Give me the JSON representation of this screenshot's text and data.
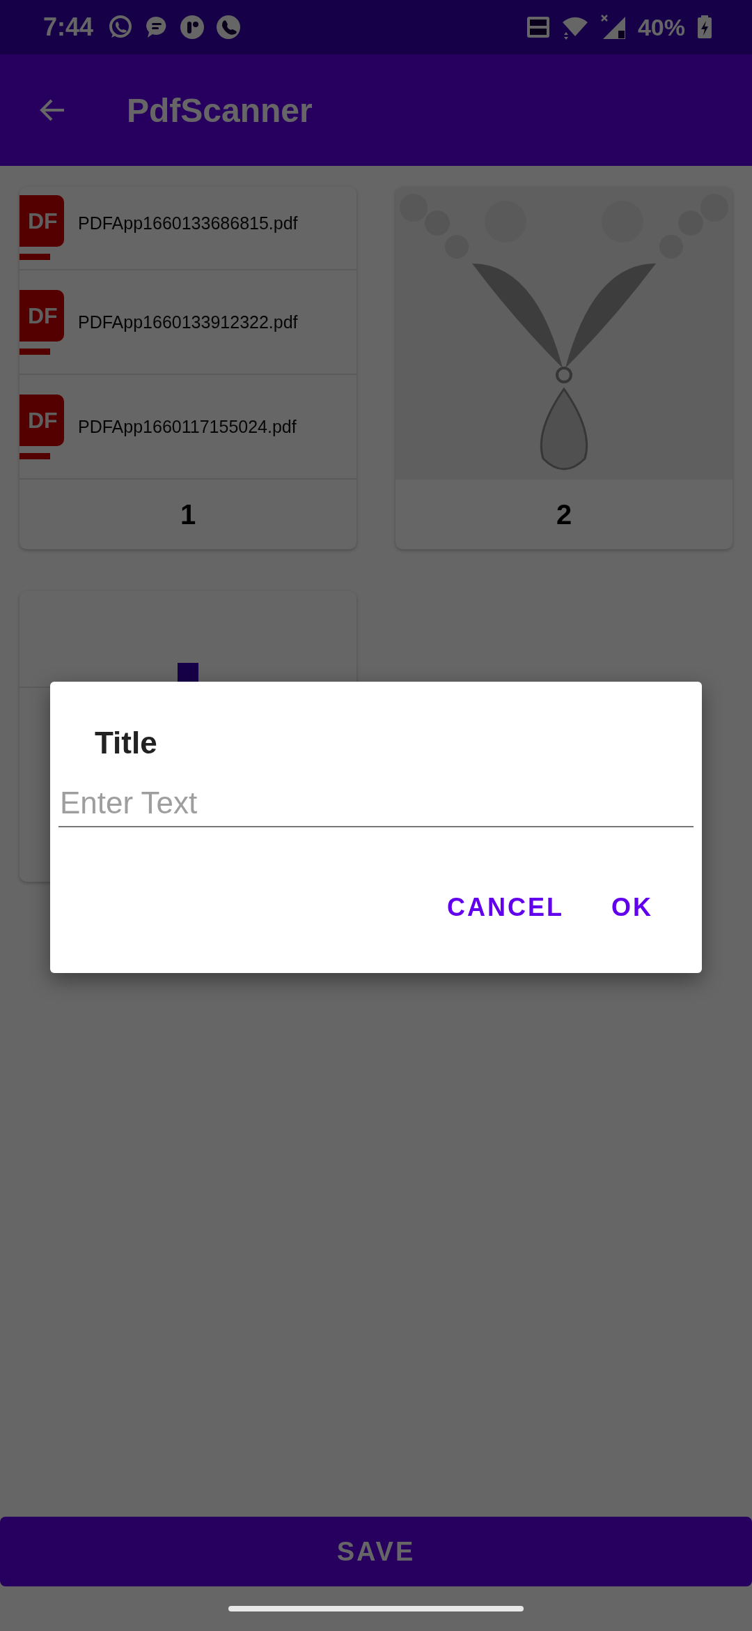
{
  "status_bar": {
    "time": "7:44",
    "battery": "40%"
  },
  "app_bar": {
    "title": "PdfScanner"
  },
  "cards": [
    {
      "kind": "file-list",
      "label": "1",
      "files": [
        {
          "name": "PDFApp1660133686815.pdf",
          "icon_label": "DF"
        },
        {
          "name": "PDFApp1660133912322.pdf",
          "icon_label": "DF"
        },
        {
          "name": "PDFApp1660117155024.pdf",
          "icon_label": "DF"
        }
      ]
    },
    {
      "kind": "picture",
      "label": "2"
    },
    {
      "kind": "blank"
    }
  ],
  "dialog": {
    "title": "Title",
    "placeholder": "Enter Text",
    "buttons": [
      "CANCEL",
      "OK"
    ]
  },
  "save_button": "SAVE"
}
